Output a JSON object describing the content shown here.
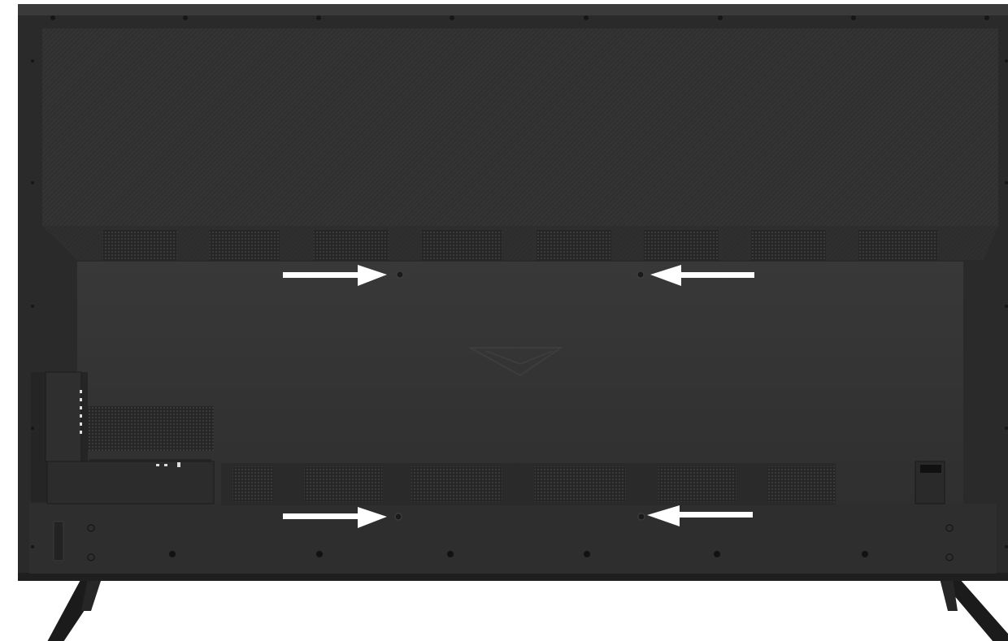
{
  "image": {
    "subject": "rear-view-of-flat-screen-tv",
    "colors": {
      "background": "#ffffff",
      "frame": "#2a2a2a",
      "panel": "#343434",
      "vent": "#2b2b2b",
      "arrow": "#ffffff",
      "screw": "#161616"
    },
    "annotations": {
      "arrow_count": 4,
      "arrows": [
        {
          "name": "arrow-top-left",
          "direction": "right"
        },
        {
          "name": "arrow-top-right",
          "direction": "left"
        },
        {
          "name": "arrow-bottom-left",
          "direction": "right"
        },
        {
          "name": "arrow-bottom-right",
          "direction": "left"
        }
      ],
      "mount_points": [
        "mount-hole-top-left",
        "mount-hole-top-right",
        "mount-hole-bottom-left",
        "mount-hole-bottom-right"
      ]
    }
  }
}
